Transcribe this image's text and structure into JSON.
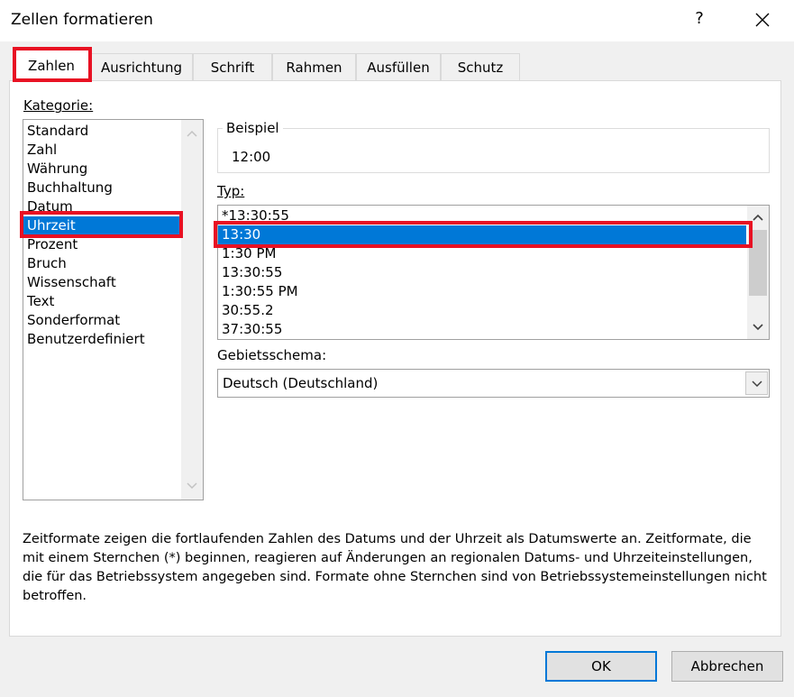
{
  "window": {
    "title": "Zellen formatieren",
    "help_glyph": "?"
  },
  "tabs": [
    "Zahlen",
    "Ausrichtung",
    "Schrift",
    "Rahmen",
    "Ausfüllen",
    "Schutz"
  ],
  "active_tab": "Zahlen",
  "category": {
    "label": "Kategorie:",
    "items": [
      "Standard",
      "Zahl",
      "Währung",
      "Buchhaltung",
      "Datum",
      "Uhrzeit",
      "Prozent",
      "Bruch",
      "Wissenschaft",
      "Text",
      "Sonderformat",
      "Benutzerdefiniert"
    ],
    "selected": "Uhrzeit"
  },
  "sample": {
    "label": "Beispiel",
    "value": "12:00"
  },
  "type": {
    "label": "Typ:",
    "items": [
      "*13:30:55",
      "13:30",
      "1:30 PM",
      "13:30:55",
      "1:30:55 PM",
      "30:55.2",
      "37:30:55"
    ],
    "selected": "13:30"
  },
  "locale": {
    "label": "Gebietsschema:",
    "value": "Deutsch (Deutschland)"
  },
  "description": "Zeitformate zeigen die fortlaufenden Zahlen des Datums und der Uhrzeit als Datumswerte an. Zeitformate, die mit einem Sternchen (*) beginnen, reagieren auf Änderungen an regionalen Datums- und Uhrzeiteinstellungen, die für das Betriebssystem angegeben sind. Formate ohne Sternchen sind von Betriebssystemeinstellungen nicht betroffen.",
  "buttons": {
    "ok": "OK",
    "cancel": "Abbrechen"
  },
  "colors": {
    "selection": "#0078d7",
    "highlight_border": "#e81123"
  }
}
